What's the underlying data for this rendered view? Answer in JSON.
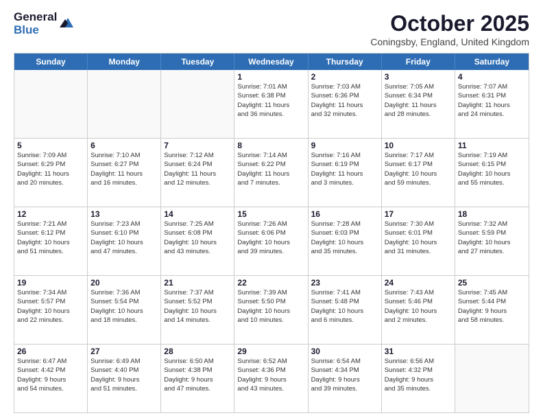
{
  "header": {
    "logo_general": "General",
    "logo_blue": "Blue",
    "month_title": "October 2025",
    "location": "Coningsby, England, United Kingdom"
  },
  "day_headers": [
    "Sunday",
    "Monday",
    "Tuesday",
    "Wednesday",
    "Thursday",
    "Friday",
    "Saturday"
  ],
  "weeks": [
    [
      {
        "day": "",
        "info": ""
      },
      {
        "day": "",
        "info": ""
      },
      {
        "day": "",
        "info": ""
      },
      {
        "day": "1",
        "info": "Sunrise: 7:01 AM\nSunset: 6:38 PM\nDaylight: 11 hours\nand 36 minutes."
      },
      {
        "day": "2",
        "info": "Sunrise: 7:03 AM\nSunset: 6:36 PM\nDaylight: 11 hours\nand 32 minutes."
      },
      {
        "day": "3",
        "info": "Sunrise: 7:05 AM\nSunset: 6:34 PM\nDaylight: 11 hours\nand 28 minutes."
      },
      {
        "day": "4",
        "info": "Sunrise: 7:07 AM\nSunset: 6:31 PM\nDaylight: 11 hours\nand 24 minutes."
      }
    ],
    [
      {
        "day": "5",
        "info": "Sunrise: 7:09 AM\nSunset: 6:29 PM\nDaylight: 11 hours\nand 20 minutes."
      },
      {
        "day": "6",
        "info": "Sunrise: 7:10 AM\nSunset: 6:27 PM\nDaylight: 11 hours\nand 16 minutes."
      },
      {
        "day": "7",
        "info": "Sunrise: 7:12 AM\nSunset: 6:24 PM\nDaylight: 11 hours\nand 12 minutes."
      },
      {
        "day": "8",
        "info": "Sunrise: 7:14 AM\nSunset: 6:22 PM\nDaylight: 11 hours\nand 7 minutes."
      },
      {
        "day": "9",
        "info": "Sunrise: 7:16 AM\nSunset: 6:19 PM\nDaylight: 11 hours\nand 3 minutes."
      },
      {
        "day": "10",
        "info": "Sunrise: 7:17 AM\nSunset: 6:17 PM\nDaylight: 10 hours\nand 59 minutes."
      },
      {
        "day": "11",
        "info": "Sunrise: 7:19 AM\nSunset: 6:15 PM\nDaylight: 10 hours\nand 55 minutes."
      }
    ],
    [
      {
        "day": "12",
        "info": "Sunrise: 7:21 AM\nSunset: 6:12 PM\nDaylight: 10 hours\nand 51 minutes."
      },
      {
        "day": "13",
        "info": "Sunrise: 7:23 AM\nSunset: 6:10 PM\nDaylight: 10 hours\nand 47 minutes."
      },
      {
        "day": "14",
        "info": "Sunrise: 7:25 AM\nSunset: 6:08 PM\nDaylight: 10 hours\nand 43 minutes."
      },
      {
        "day": "15",
        "info": "Sunrise: 7:26 AM\nSunset: 6:06 PM\nDaylight: 10 hours\nand 39 minutes."
      },
      {
        "day": "16",
        "info": "Sunrise: 7:28 AM\nSunset: 6:03 PM\nDaylight: 10 hours\nand 35 minutes."
      },
      {
        "day": "17",
        "info": "Sunrise: 7:30 AM\nSunset: 6:01 PM\nDaylight: 10 hours\nand 31 minutes."
      },
      {
        "day": "18",
        "info": "Sunrise: 7:32 AM\nSunset: 5:59 PM\nDaylight: 10 hours\nand 27 minutes."
      }
    ],
    [
      {
        "day": "19",
        "info": "Sunrise: 7:34 AM\nSunset: 5:57 PM\nDaylight: 10 hours\nand 22 minutes."
      },
      {
        "day": "20",
        "info": "Sunrise: 7:36 AM\nSunset: 5:54 PM\nDaylight: 10 hours\nand 18 minutes."
      },
      {
        "day": "21",
        "info": "Sunrise: 7:37 AM\nSunset: 5:52 PM\nDaylight: 10 hours\nand 14 minutes."
      },
      {
        "day": "22",
        "info": "Sunrise: 7:39 AM\nSunset: 5:50 PM\nDaylight: 10 hours\nand 10 minutes."
      },
      {
        "day": "23",
        "info": "Sunrise: 7:41 AM\nSunset: 5:48 PM\nDaylight: 10 hours\nand 6 minutes."
      },
      {
        "day": "24",
        "info": "Sunrise: 7:43 AM\nSunset: 5:46 PM\nDaylight: 10 hours\nand 2 minutes."
      },
      {
        "day": "25",
        "info": "Sunrise: 7:45 AM\nSunset: 5:44 PM\nDaylight: 9 hours\nand 58 minutes."
      }
    ],
    [
      {
        "day": "26",
        "info": "Sunrise: 6:47 AM\nSunset: 4:42 PM\nDaylight: 9 hours\nand 54 minutes."
      },
      {
        "day": "27",
        "info": "Sunrise: 6:49 AM\nSunset: 4:40 PM\nDaylight: 9 hours\nand 51 minutes."
      },
      {
        "day": "28",
        "info": "Sunrise: 6:50 AM\nSunset: 4:38 PM\nDaylight: 9 hours\nand 47 minutes."
      },
      {
        "day": "29",
        "info": "Sunrise: 6:52 AM\nSunset: 4:36 PM\nDaylight: 9 hours\nand 43 minutes."
      },
      {
        "day": "30",
        "info": "Sunrise: 6:54 AM\nSunset: 4:34 PM\nDaylight: 9 hours\nand 39 minutes."
      },
      {
        "day": "31",
        "info": "Sunrise: 6:56 AM\nSunset: 4:32 PM\nDaylight: 9 hours\nand 35 minutes."
      },
      {
        "day": "",
        "info": ""
      }
    ]
  ]
}
